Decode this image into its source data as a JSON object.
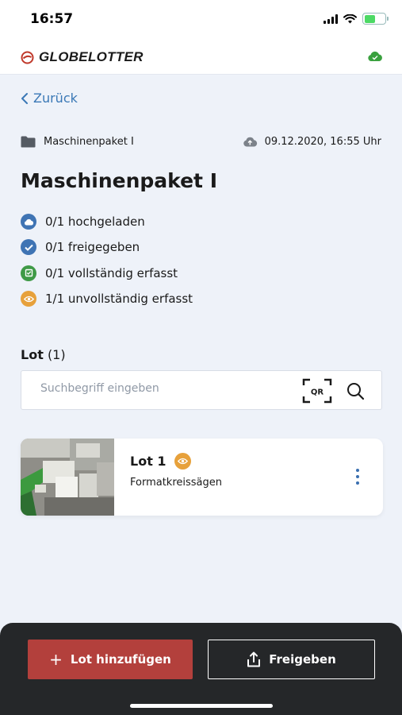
{
  "status_bar": {
    "time": "16:57"
  },
  "header": {
    "brand": "GLOBELOTTER"
  },
  "nav": {
    "back_label": "Zurück"
  },
  "package": {
    "folder_name": "Maschinenpaket I",
    "timestamp": "09.12.2020, 16:55 Uhr",
    "title": "Maschinenpaket I"
  },
  "status_items": [
    {
      "label": "0/1 hochgeladen",
      "color": "#3f74b4",
      "icon": "cloud-icon"
    },
    {
      "label": "0/1 freigegeben",
      "color": "#3f74b4",
      "icon": "check-icon"
    },
    {
      "label": "0/1 vollständig erfasst",
      "color": "#3f9a47",
      "icon": "complete-icon"
    },
    {
      "label": "1/1 unvollständig erfasst",
      "color": "#e7a13b",
      "icon": "eye-icon"
    }
  ],
  "lots": {
    "heading": "Lot",
    "count": "(1)",
    "search_placeholder": "Suchbegriff eingeben",
    "qr_label": "QR",
    "items": [
      {
        "name": "Lot 1",
        "subtitle": "Formatkreissägen",
        "status_icon": "eye-icon"
      }
    ]
  },
  "actions": {
    "add_label": "Lot hinzufügen",
    "share_label": "Freigeben"
  },
  "colors": {
    "accent_blue": "#3a78b6",
    "add_button": "#b3403c",
    "bottom_bar": "#252729",
    "cloud_green": "#3aa13f",
    "warning_orange": "#e7a13b"
  }
}
